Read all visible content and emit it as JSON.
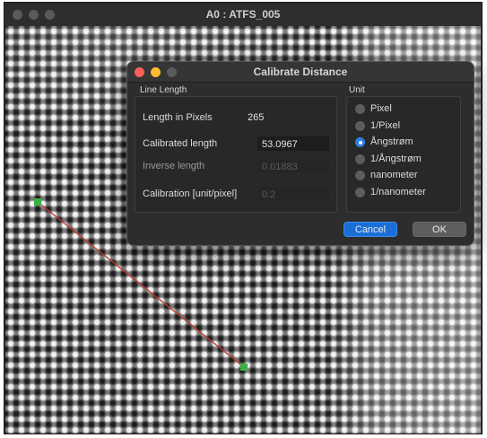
{
  "window": {
    "title": "A0 : ATFS_005"
  },
  "dialog": {
    "title": "Calibrate Distance",
    "line_length_group": "Line Length",
    "length_in_pixels_label": "Length in Pixels",
    "length_in_pixels_value": "265",
    "calibrated_length_label": "Calibrated length",
    "calibrated_length_value": "53.0967",
    "inverse_length_label": "Inverse length",
    "inverse_length_value": "0.01883",
    "calibration_label": "Calibration [unit/pixel]",
    "calibration_value": "0.2",
    "unit_group": "Unit",
    "units": [
      {
        "label": "Pixel",
        "selected": false
      },
      {
        "label": "1/Pixel",
        "selected": false
      },
      {
        "label": "Ångstrøm",
        "selected": true
      },
      {
        "label": "1/Ångstrøm",
        "selected": false
      },
      {
        "label": "nanometer",
        "selected": false
      },
      {
        "label": "1/nanometer",
        "selected": false
      }
    ],
    "cancel_label": "Cancel",
    "ok_label": "OK"
  },
  "colors": {
    "accent": "#1a6fd6",
    "measure_line": "#c0392b",
    "measure_handle": "#3cb043",
    "close_dot": "#fe5f57",
    "minimize_dot": "#febc2e"
  }
}
